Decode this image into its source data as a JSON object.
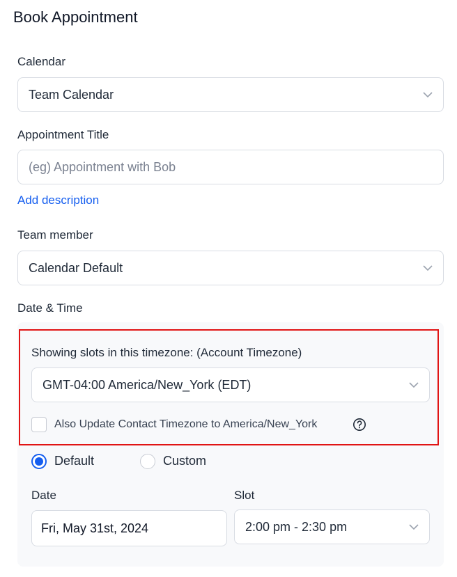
{
  "header": {
    "title": "Book Appointment"
  },
  "calendar": {
    "label": "Calendar",
    "value": "Team Calendar"
  },
  "appointment_title": {
    "label": "Appointment Title",
    "placeholder": "(eg) Appointment with Bob",
    "value": ""
  },
  "add_description": "Add description",
  "team_member": {
    "label": "Team member",
    "value": "Calendar Default"
  },
  "date_time": {
    "label": "Date & Time",
    "timezone_label": "Showing slots in this timezone: (Account Timezone)",
    "timezone_value": "GMT-04:00 America/New_York (EDT)",
    "update_contact_tz_label": "Also Update Contact Timezone to America/New_York",
    "update_contact_tz_checked": false,
    "mode_options": [
      {
        "label": "Default",
        "selected": true
      },
      {
        "label": "Custom",
        "selected": false
      }
    ],
    "date_label": "Date",
    "date_value": "Fri, May 31st, 2024",
    "slot_label": "Slot",
    "slot_value": "2:00 pm - 2:30 pm"
  },
  "colors": {
    "accent": "#155eef",
    "highlight_border": "#e11414",
    "panel_bg": "#f8f9fb"
  }
}
